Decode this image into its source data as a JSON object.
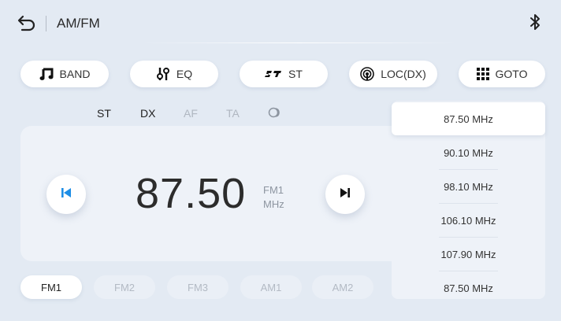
{
  "header": {
    "title": "AM/FM"
  },
  "toolbar": [
    {
      "label": "BAND",
      "icon": "music-note-icon"
    },
    {
      "label": "EQ",
      "icon": "equalizer-icon"
    },
    {
      "label": "ST",
      "icon": "stereo-icon"
    },
    {
      "label": "LOC(DX)",
      "icon": "antenna-icon"
    },
    {
      "label": "GOTO",
      "icon": "keypad-icon"
    }
  ],
  "indicators": [
    {
      "label": "ST",
      "active": true
    },
    {
      "label": "DX",
      "active": true
    },
    {
      "label": "AF",
      "active": false
    },
    {
      "label": "TA",
      "active": false
    }
  ],
  "tuner": {
    "frequency": "87.50",
    "band": "FM1",
    "unit": "MHz"
  },
  "presets": [
    {
      "label": "FM1",
      "selected": true
    },
    {
      "label": "FM2",
      "selected": false
    },
    {
      "label": "FM3",
      "selected": false
    },
    {
      "label": "AM1",
      "selected": false
    },
    {
      "label": "AM2",
      "selected": false
    }
  ],
  "stations": [
    {
      "label": "87.50 MHz",
      "selected": true
    },
    {
      "label": "90.10 MHz",
      "selected": false
    },
    {
      "label": "98.10 MHz",
      "selected": false
    },
    {
      "label": "106.10 MHz",
      "selected": false
    },
    {
      "label": "107.90 MHz",
      "selected": false
    },
    {
      "label": "87.50 MHz",
      "selected": false
    }
  ],
  "colors": {
    "background": "#e3eaf3",
    "panel": "#eef2f8",
    "accent": "#1e8ee6",
    "text": "#222222",
    "inactive": "#b0b7c1"
  }
}
